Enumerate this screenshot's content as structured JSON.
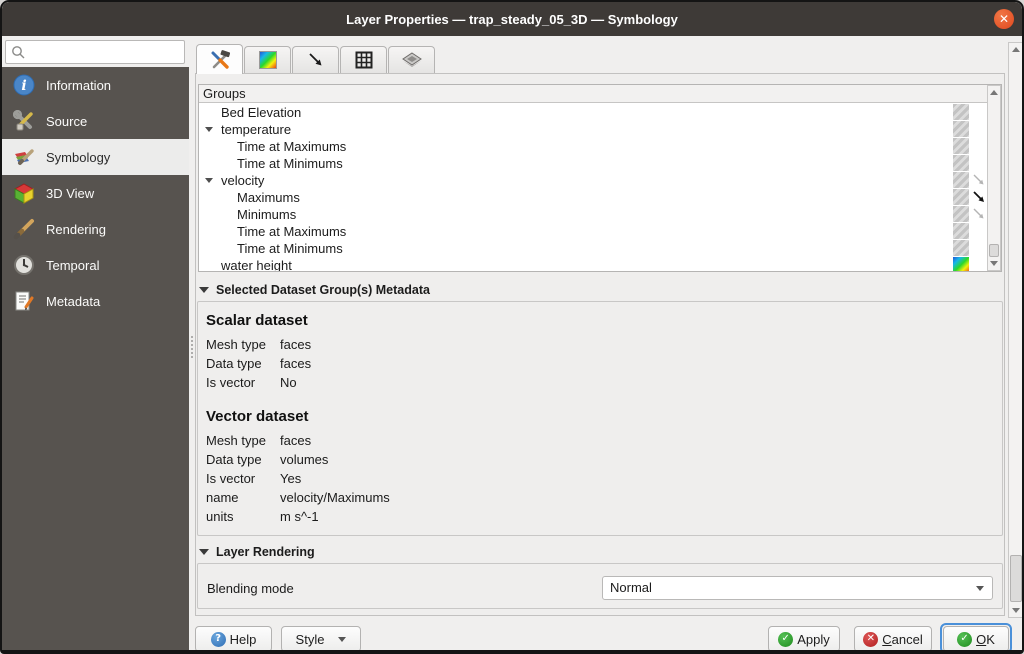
{
  "window": {
    "title": "Layer Properties — trap_steady_05_3D — Symbology",
    "close_glyph": "✕"
  },
  "sidebar": {
    "search_placeholder": "",
    "items": [
      {
        "label": "Information"
      },
      {
        "label": "Source"
      },
      {
        "label": "Symbology"
      },
      {
        "label": "3D View"
      },
      {
        "label": "Rendering"
      },
      {
        "label": "Temporal"
      },
      {
        "label": "Metadata"
      }
    ]
  },
  "tree": {
    "header": "Groups",
    "rows": [
      {
        "label": "Bed Elevation"
      },
      {
        "label": "temperature"
      },
      {
        "label": "Time at Maximums"
      },
      {
        "label": "Time at Minimums"
      },
      {
        "label": "velocity"
      },
      {
        "label": "Maximums"
      },
      {
        "label": "Minimums"
      },
      {
        "label": "Time at Maximums"
      },
      {
        "label": "Time at Minimums"
      },
      {
        "label": "water height"
      }
    ]
  },
  "metadata": {
    "header": "Selected Dataset Group(s) Metadata",
    "scalar": {
      "title": "Scalar dataset",
      "rows": [
        {
          "label": "Mesh type",
          "value": "faces"
        },
        {
          "label": "Data type",
          "value": "faces"
        },
        {
          "label": "Is vector",
          "value": "No"
        }
      ]
    },
    "vector": {
      "title": "Vector dataset",
      "rows": [
        {
          "label": "Mesh type",
          "value": "faces"
        },
        {
          "label": "Data type",
          "value": "volumes"
        },
        {
          "label": "Is vector",
          "value": "Yes"
        },
        {
          "label": "name",
          "value": "velocity/Maximums"
        },
        {
          "label": "units",
          "value": "m s^-1"
        }
      ]
    }
  },
  "rendering": {
    "header": "Layer Rendering",
    "blending_label": "Blending mode",
    "blending_value": "Normal"
  },
  "footer": {
    "help": "Help",
    "style": "Style",
    "apply": "Apply",
    "cancel_accel": "C",
    "cancel_rest": "ancel",
    "ok_accel": "O",
    "ok_rest": "K"
  },
  "icons": {
    "info_glyph": "i",
    "help_glyph": "?",
    "check_glyph": "✓",
    "cross_glyph": "✕"
  },
  "colors": {
    "titlebar": "#3e3a37",
    "sidebar": "#57534f",
    "close_button": "#e1481e",
    "focus_ring": "#4a90d9"
  }
}
